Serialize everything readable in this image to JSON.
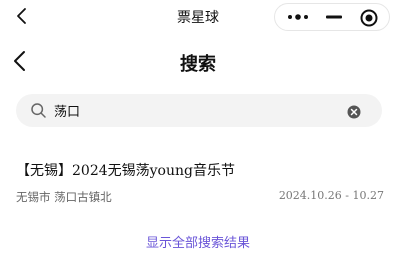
{
  "app": {
    "title": "票星球"
  },
  "page": {
    "title": "搜索"
  },
  "search": {
    "value": "荡口"
  },
  "results": [
    {
      "title": "【无锡】2024无锡荡young音乐节",
      "location": "无锡市 荡口古镇北",
      "date": "2024.10.26 - 10.27"
    }
  ],
  "show_all_label": "显示全部搜索结果",
  "colors": {
    "accent": "#6a55d8",
    "search_bg": "#f3f3f3"
  },
  "icons": {
    "titlebar_back": "chevron-left-icon",
    "capsule": [
      "more-dots-icon",
      "minimize-icon",
      "close-circle-icon"
    ],
    "header_back": "chevron-left-icon",
    "search": "search-icon",
    "clear": "clear-input-icon"
  }
}
